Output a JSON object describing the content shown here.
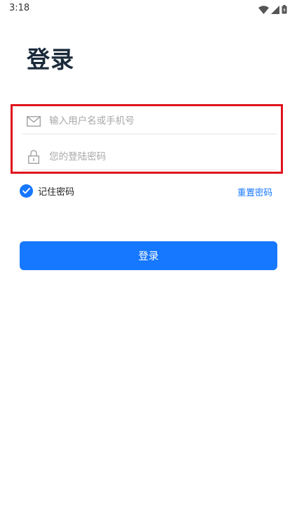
{
  "status_bar": {
    "time": "3:18"
  },
  "page": {
    "title": "登录"
  },
  "form": {
    "username_placeholder": "输入用户名或手机号",
    "password_placeholder": "您的登陆密码",
    "username_icon": "mail-icon",
    "password_icon": "lock-icon"
  },
  "options": {
    "remember_label": "记住密码",
    "remember_checked": true,
    "reset_label": "重置密码"
  },
  "actions": {
    "login_label": "登录"
  },
  "colors": {
    "primary": "#1677ff",
    "highlight_border": "#e0141e",
    "title": "#1a2a3a"
  }
}
